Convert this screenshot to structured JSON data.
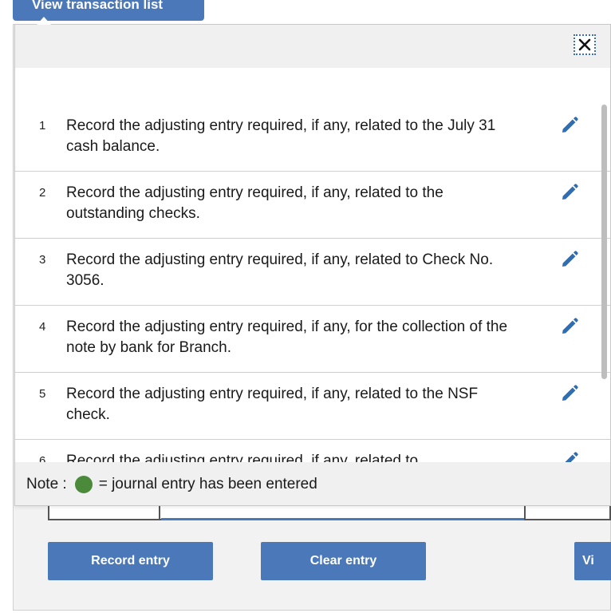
{
  "top_tab": {
    "label": "View transaction list"
  },
  "modal": {
    "items": [
      {
        "num": "1",
        "text": "Record the adjusting entry required, if any, related to the July 31 cash balance."
      },
      {
        "num": "2",
        "text": "Record the adjusting entry required, if any, related to the outstanding checks."
      },
      {
        "num": "3",
        "text": "Record the adjusting entry required, if any, related to Check No. 3056."
      },
      {
        "num": "4",
        "text": "Record the adjusting entry required, if any, for the collection of the note by bank for Branch."
      },
      {
        "num": "5",
        "text": "Record the adjusting entry required, if any, related to the NSF check."
      },
      {
        "num": "6",
        "text": "Record the adjusting entry required, if any, related to"
      }
    ],
    "note": {
      "prefix": "Note :",
      "suffix": "= journal entry has been entered"
    }
  },
  "buttons": {
    "record": "Record entry",
    "clear": "Clear entry",
    "view": "Vi"
  },
  "colors": {
    "accent": "#4a78b8",
    "entered_dot": "#4a8a3a"
  }
}
